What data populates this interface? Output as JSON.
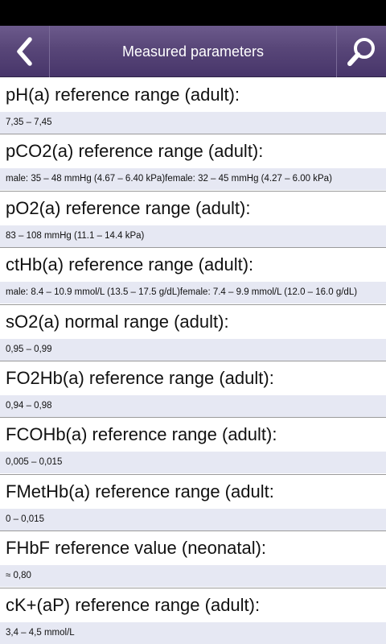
{
  "header": {
    "title": "Measured parameters"
  },
  "items": [
    {
      "title": "pH(a) reference range (adult):",
      "value": "7,35 – 7,45"
    },
    {
      "title": "pCO2(a) reference range (adult):",
      "value": "male: 35 – 48 mmHg (4.67 – 6.40 kPa)female: 32 – 45 mmHg (4.27 – 6.00 kPa)"
    },
    {
      "title": "pO2(a) reference range (adult):",
      "value": "83 – 108 mmHg (11.1 – 14.4 kPa)"
    },
    {
      "title": "ctHb(a) reference range (adult):",
      "value": "male: 8.4 – 10.9 mmol/L (13.5 – 17.5 g/dL)female: 7.4 – 9.9 mmol/L (12.0 – 16.0 g/dL)"
    },
    {
      "title": "sO2(a) normal range (adult):",
      "value": "0,95 – 0,99"
    },
    {
      "title": "FO2Hb(a) reference range (adult):",
      "value": "0,94 – 0,98"
    },
    {
      "title": "FCOHb(a) reference range (adult):",
      "value": "0,005 – 0,015"
    },
    {
      "title": "FMetHb(a) reference range (adult:",
      "value": "0 – 0,015"
    },
    {
      "title": "FHbF reference value (neonatal):",
      "value": "≈ 0,80"
    },
    {
      "title": "cK+(aP) reference range (adult):",
      "value": "3,4 – 4,5 mmol/L"
    }
  ],
  "icons": {
    "back": "chevron-left-icon",
    "search": "search-icon"
  }
}
